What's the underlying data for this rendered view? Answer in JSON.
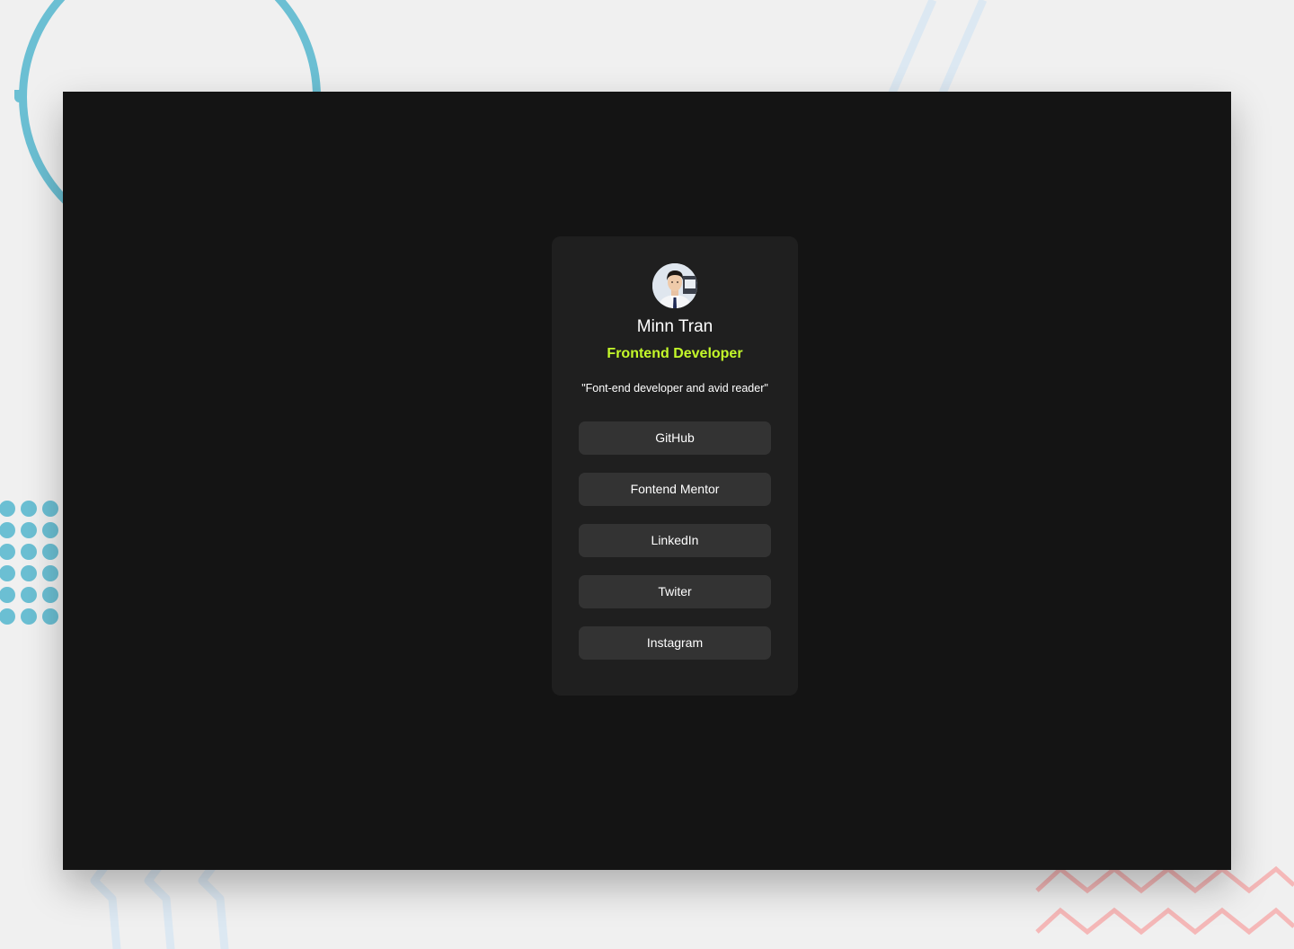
{
  "profile": {
    "name": "Minn Tran",
    "role": "Frontend Developer",
    "bio": "\"Font-end developer and avid reader\"",
    "avatar_icon": "avatar-photo"
  },
  "links": [
    {
      "label": "GitHub"
    },
    {
      "label": "Fontend Mentor"
    },
    {
      "label": "LinkedIn"
    },
    {
      "label": "Twiter"
    },
    {
      "label": "Instagram"
    }
  ],
  "colors": {
    "page_background": "#f0f0f0",
    "frame_background": "#141414",
    "card_background": "#1f1f1f",
    "button_background": "#333333",
    "accent_green": "#c4f82a",
    "deco_blue": "#6bbfd3",
    "deco_light_blue": "#dce8f2",
    "deco_pink": "#f5b8b8"
  }
}
